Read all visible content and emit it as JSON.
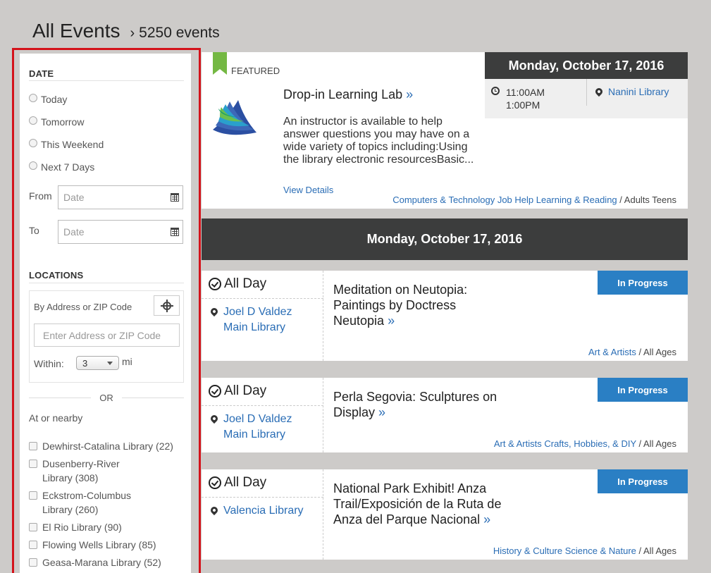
{
  "header": {
    "title": "All Events",
    "count": "5250 events"
  },
  "sidebar": {
    "date_title": "DATE",
    "date_options": [
      "Today",
      "Tomorrow",
      "This Weekend",
      "Next 7 Days"
    ],
    "from_label": "From",
    "to_label": "To",
    "date_placeholder": "Date",
    "locations_title": "LOCATIONS",
    "by_address_label": "By Address or ZIP Code",
    "address_placeholder": "Enter Address or ZIP Code",
    "within_label": "Within:",
    "within_value": "3",
    "mi_label": "mi",
    "or_label": "OR",
    "nearby_label": "At or nearby",
    "libraries": [
      "Dewhirst-Catalina Library (22)",
      "Dusenberry-River Library (308)",
      "Eckstrom-Columbus Library (260)",
      "El Rio Library (90)",
      "Flowing Wells Library (85)",
      "Geasa-Marana Library (52)"
    ]
  },
  "featured": {
    "label": "FEATURED",
    "title": "Drop-in Learning Lab",
    "description": "An instructor is available to help answer questions you may have on a wide variety of topics including:Using the library electronic resourcesBasic...",
    "view_details": "View Details",
    "categories": "Computers & Technology Job Help Learning & Reading",
    "audience": "Adults Teens",
    "date": "Monday, October 17, 2016",
    "time_start": "11:00AM",
    "time_end": "1:00PM",
    "location": "Nanini Library"
  },
  "date_bar": "Monday, October 17, 2016",
  "events": [
    {
      "time": "All Day",
      "location_line1": "Joel D Valdez",
      "location_line2": "Main Library",
      "title_line1": "Meditation on Neutopia:",
      "title_line2": "Paintings by Doctress",
      "title_line3": "Neutopia",
      "badge": "In Progress",
      "categories": "Art & Artists",
      "audience": "All Ages"
    },
    {
      "time": "All Day",
      "location_line1": "Joel D Valdez",
      "location_line2": "Main Library",
      "title_line1": "Perla Segovia: Sculptures on",
      "title_line2": "Display",
      "badge": "In Progress",
      "categories": "Art & Artists Crafts, Hobbies, & DIY",
      "audience": "All Ages"
    },
    {
      "time": "All Day",
      "location_line1": "Valencia Library",
      "title_line1": "National Park Exhibit! Anza",
      "title_line2": "Trail/Exposición de la Ruta de",
      "title_line3": "Anza del Parque Nacional",
      "badge": "In Progress",
      "categories": "History & Culture Science & Nature",
      "audience": "All Ages"
    }
  ]
}
